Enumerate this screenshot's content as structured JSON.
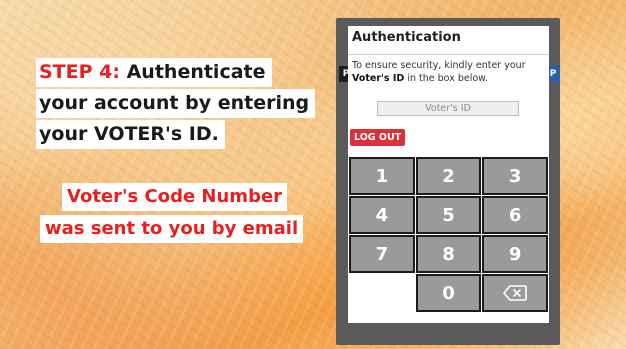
{
  "instructions": {
    "step_label": "STEP 4:",
    "line1_rest": " Authenticate",
    "line2": "your account by entering",
    "line3": "your VOTER's ID.",
    "note_line1": "Voter's Code Number",
    "note_line2": "was sent to you by email"
  },
  "device": {
    "left_edge_label": "P",
    "right_edge_label": "P"
  },
  "dialog": {
    "title": "Authentication",
    "message_intro": "To ensure security, kindly enter your",
    "message_bold": "Voter's ID",
    "message_rest": " in the box below.",
    "voter_id_value": "",
    "voter_id_placeholder": "Voter's ID",
    "logout_label": "LOG OUT"
  },
  "keypad": {
    "keys": [
      "1",
      "2",
      "3",
      "4",
      "5",
      "6",
      "7",
      "8",
      "9",
      "",
      "0",
      "backspace"
    ],
    "backspace_icon": "backspace-icon"
  },
  "colors": {
    "step_red": "#e81f1f",
    "logout_red": "#d9323b",
    "key_gray": "#9a9a9a",
    "device_gray": "#5a5a5a"
  }
}
